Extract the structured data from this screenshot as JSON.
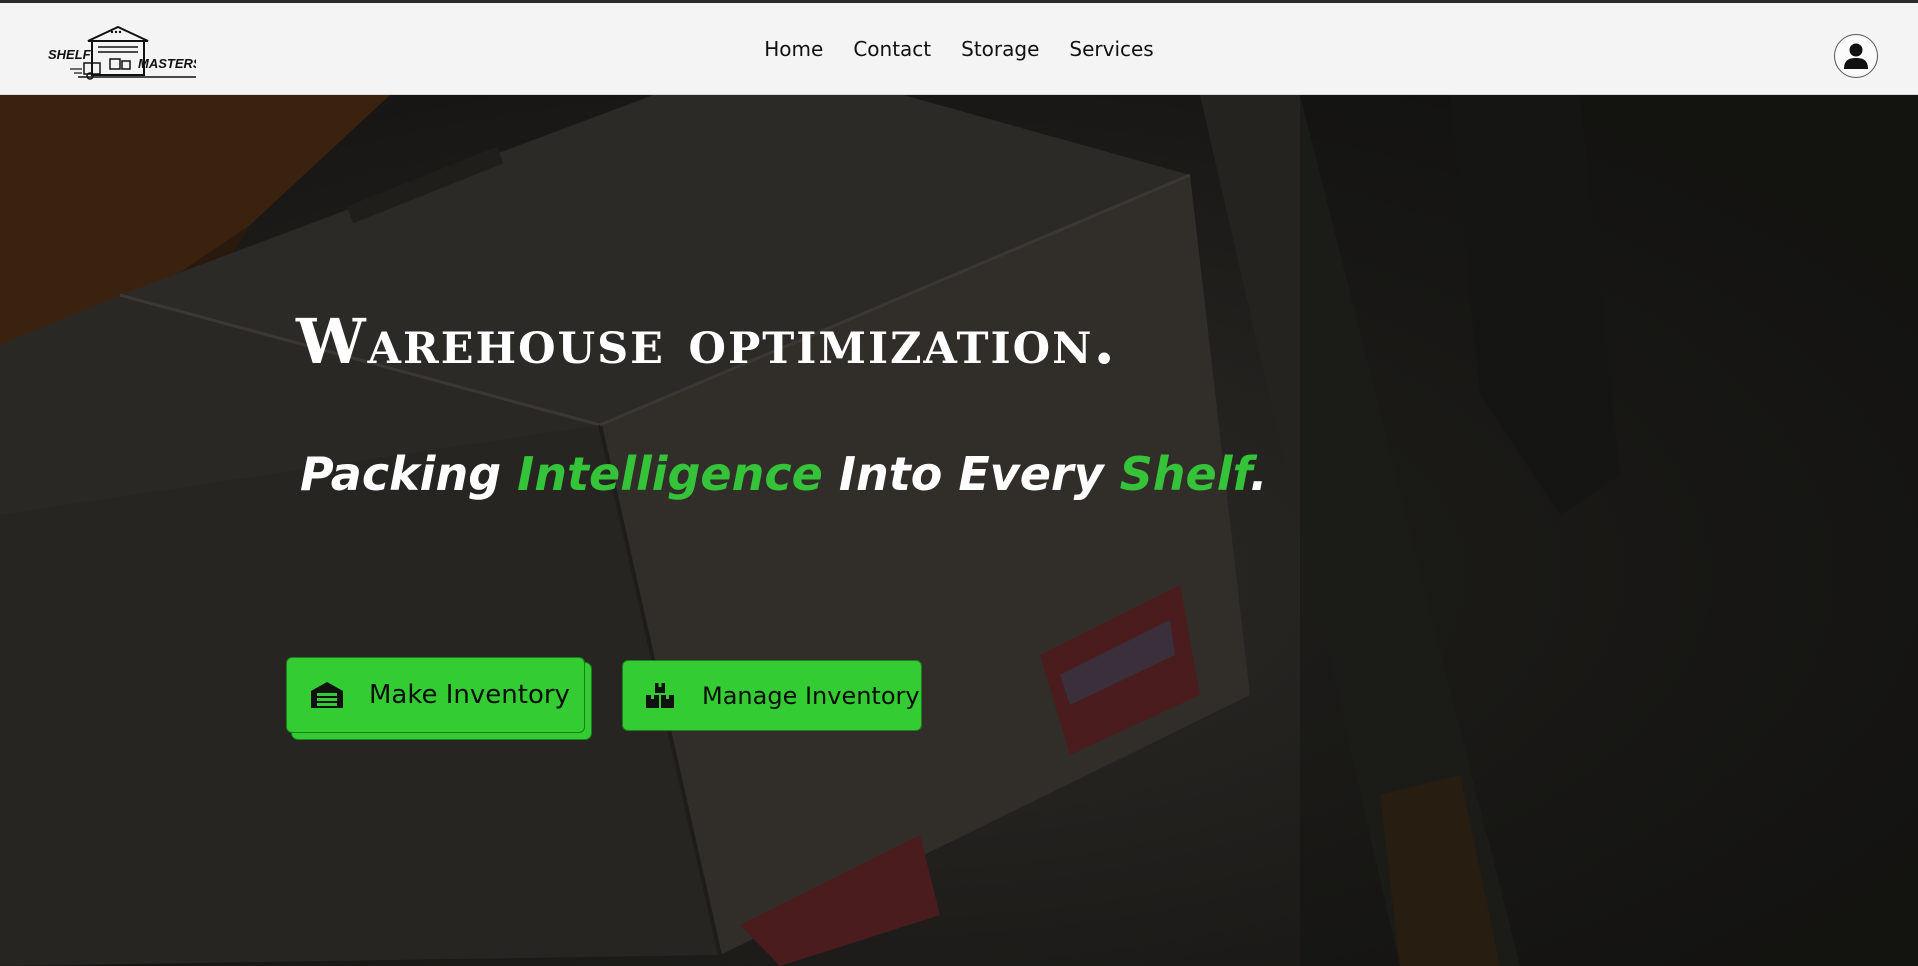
{
  "brand": {
    "logo_left_text": "SHELF",
    "logo_right_text": "MASTERS"
  },
  "nav": {
    "items": [
      {
        "label": "Home"
      },
      {
        "label": "Contact"
      },
      {
        "label": "Storage"
      },
      {
        "label": "Services"
      }
    ]
  },
  "account": {
    "icon": "user-icon"
  },
  "hero": {
    "title": "Warehouse optimization.",
    "subtitle": {
      "part1": "Packing ",
      "highlight1": "Intelligence",
      "part2": " Into Every ",
      "highlight2": "Shelf",
      "part3": "."
    },
    "accent_color": "#33cc33",
    "buttons": {
      "make_inventory": {
        "label": "Make Inventory",
        "icon": "warehouse-door-icon"
      },
      "manage_inventory": {
        "label": "Manage Inventory",
        "icon": "boxes-icon"
      }
    }
  }
}
